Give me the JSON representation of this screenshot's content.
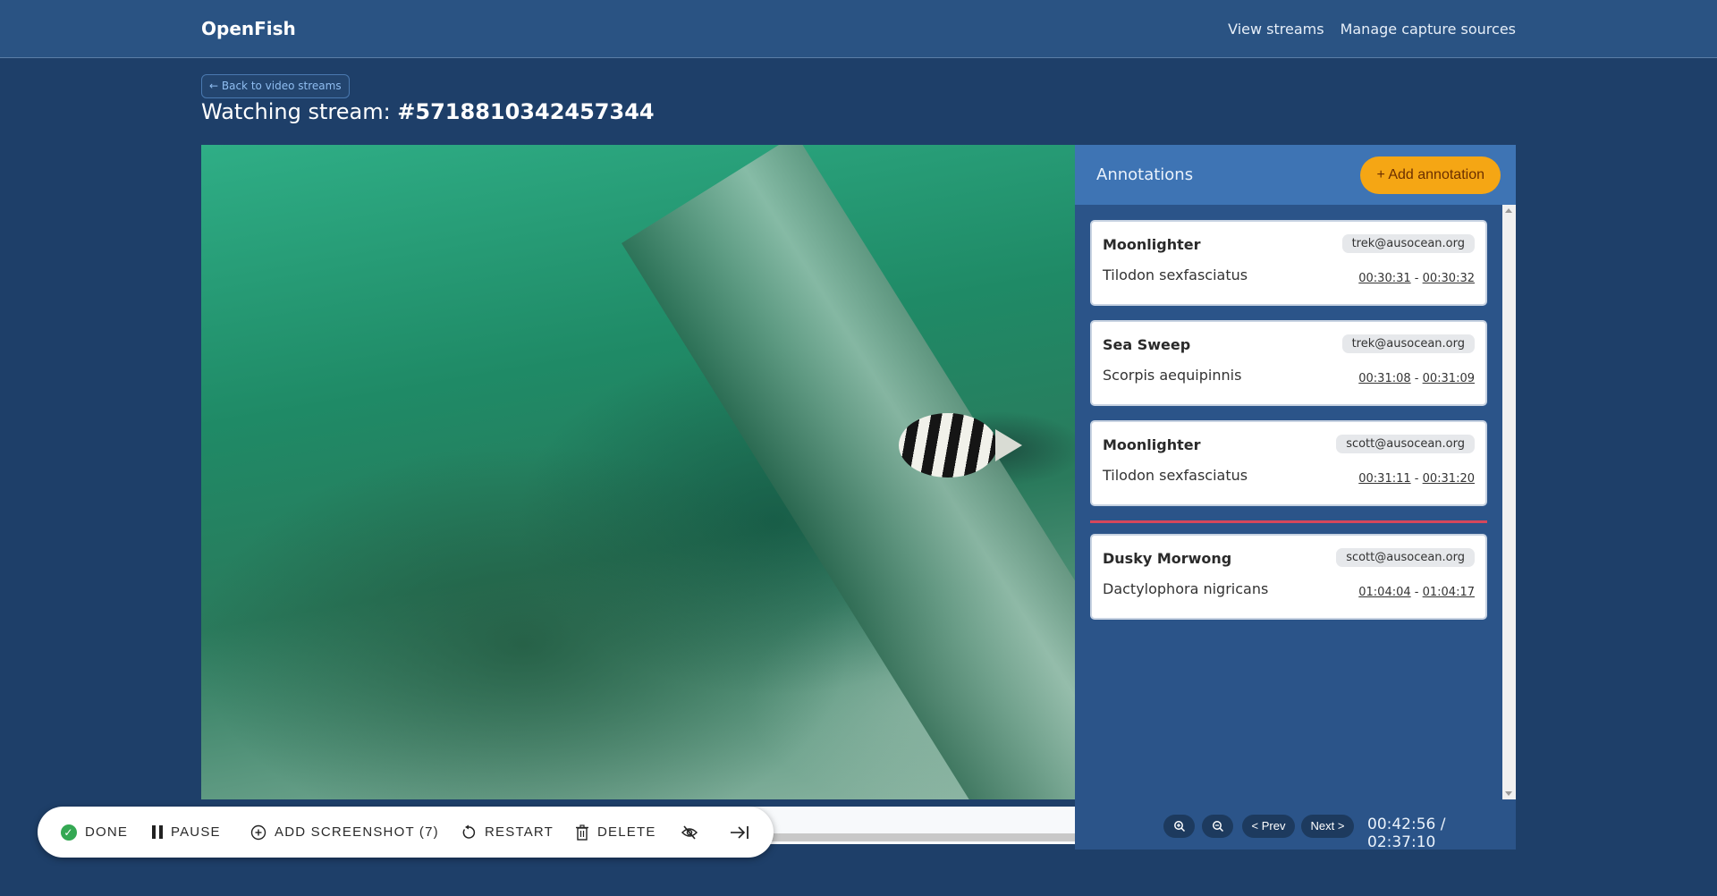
{
  "app": {
    "brand": "OpenFish"
  },
  "nav": {
    "view_streams": "View streams",
    "manage_sources": "Manage capture sources"
  },
  "back_label": "← Back to video streams",
  "page": {
    "title_prefix": "Watching stream:",
    "stream_id": "#5718810342457344"
  },
  "annotations": {
    "title": "Annotations",
    "add_label": "+ Add annotation",
    "items": [
      {
        "common": "Moonlighter",
        "scientific": "Tilodon sexfasciatus",
        "user": "trek@ausocean.org",
        "start": "00:30:31",
        "end": "00:30:32"
      },
      {
        "common": "Sea Sweep",
        "scientific": "Scorpis aequipinnis",
        "user": "trek@ausocean.org",
        "start": "00:31:08",
        "end": "00:31:09"
      },
      {
        "common": "Moonlighter",
        "scientific": "Tilodon sexfasciatus",
        "user": "scott@ausocean.org",
        "start": "00:31:11",
        "end": "00:31:20"
      },
      {
        "common": "Dusky Morwong",
        "scientific": "Dactylophora nigricans",
        "user": "scott@ausocean.org",
        "start": "01:04:04",
        "end": "01:04:17"
      }
    ]
  },
  "controls": {
    "zoom_in_icon": "zoom-in-icon",
    "zoom_out_icon": "zoom-out-icon",
    "prev_label": "< Prev",
    "next_label": "Next >",
    "current_time": "00:42:56",
    "duration": "02:37:10",
    "time_separator": "/"
  },
  "toolbar": {
    "done_label": "DONE",
    "pause_label": "PAUSE",
    "screenshot_label": "ADD SCREENSHOT (7)",
    "restart_label": "RESTART",
    "delete_label": "DELETE"
  },
  "colors": {
    "page_bg": "#1e3f69",
    "topbar_bg": "#2a5383",
    "panel_bg": "#2b5489",
    "panel_header_bg": "#3e74b4",
    "accent_button": "#f5a614",
    "timeline_marker": "#d6475b",
    "done_green": "#34a853"
  }
}
